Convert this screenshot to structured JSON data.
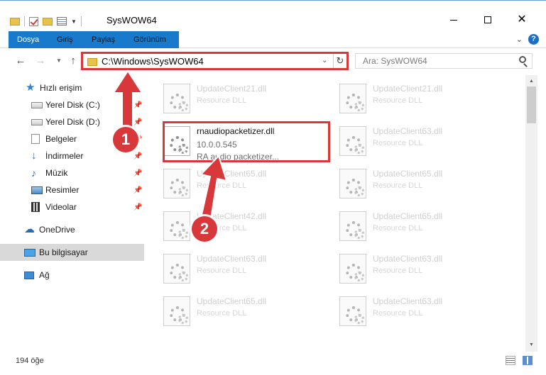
{
  "window": {
    "title": "SysWOW64"
  },
  "ribbon": {
    "tabs": [
      {
        "label": "Dosya"
      },
      {
        "label": "Giriş"
      },
      {
        "label": "Paylaş"
      },
      {
        "label": "Görünüm"
      }
    ],
    "help": "?"
  },
  "address_bar": {
    "path": "C:\\Windows\\SysWOW64"
  },
  "search": {
    "placeholder": "Ara: SysWOW64"
  },
  "nav_pane": {
    "items": [
      {
        "label": "Hızlı erişim",
        "icon": "star-icon"
      },
      {
        "label": "Yerel Disk (C:)",
        "icon": "drive-icon",
        "pinned": true
      },
      {
        "label": "Yerel Disk (D:)",
        "icon": "drive-icon",
        "pinned": true
      },
      {
        "label": "Belgeler",
        "icon": "documents-icon",
        "pinned": true
      },
      {
        "label": "İndirmeler",
        "icon": "downloads-icon",
        "pinned": true
      },
      {
        "label": "Müzik",
        "icon": "music-icon",
        "pinned": true
      },
      {
        "label": "Resimler",
        "icon": "pictures-icon",
        "pinned": true
      },
      {
        "label": "Videolar",
        "icon": "videos-icon",
        "pinned": true
      },
      {
        "label": "OneDrive",
        "icon": "cloud-icon"
      },
      {
        "label": "Bu bilgisayar",
        "icon": "computer-icon",
        "selected": true
      },
      {
        "label": "Ağ",
        "icon": "network-icon"
      }
    ]
  },
  "files": {
    "highlighted": {
      "name": "rnaudiopacketizer.dll",
      "version": "10.0.0.545",
      "description": "RA audio packetizer..."
    },
    "left_column": [
      {
        "name": "UpdateClient21.dll",
        "description": "Resource DLL"
      },
      {
        "name": "UpdateClient65.dll",
        "description": "Resource DLL"
      },
      {
        "name": "UpdateClient42.dll",
        "description": "Resource DLL"
      },
      {
        "name": "UpdateClient63.dll",
        "description": "Resource DLL"
      },
      {
        "name": "UpdateClient65.dll",
        "description": "Resource DLL"
      }
    ],
    "right_column": [
      {
        "name": "UpdateClient21.dll",
        "description": "Resource DLL"
      },
      {
        "name": "UpdateClient63.dll",
        "description": "Resource DLL"
      },
      {
        "name": "UpdateClient65.dll",
        "description": "Resource DLL"
      },
      {
        "name": "UpdateClient65.dll",
        "description": "Resource DLL"
      },
      {
        "name": "UpdateClient63.dll",
        "description": "Resource DLL"
      },
      {
        "name": "UpdateClient63.dll",
        "description": "Resource DLL"
      }
    ]
  },
  "status_bar": {
    "item_count": "194 öğe"
  },
  "annotations": {
    "step1": "1",
    "step2": "2",
    "color": "#d9383a"
  }
}
